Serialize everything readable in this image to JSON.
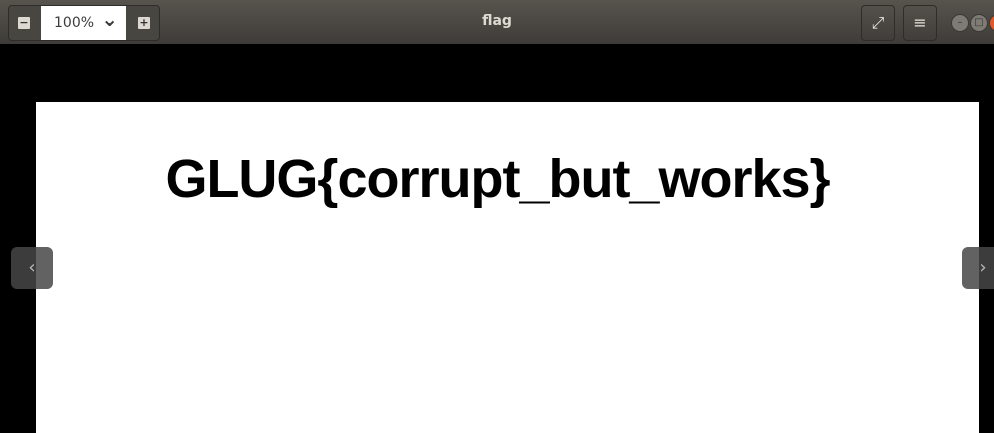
{
  "window": {
    "title": "flag"
  },
  "toolbar": {
    "zoom_value": "100%",
    "zoom_out": "−",
    "zoom_in": "+",
    "dropdown": "⌄",
    "fullscreen": "⤢",
    "menu": "≡"
  },
  "document": {
    "text": "GLUG{corrupt_but_works}"
  },
  "nav": {
    "prev": "‹",
    "next": "›"
  }
}
